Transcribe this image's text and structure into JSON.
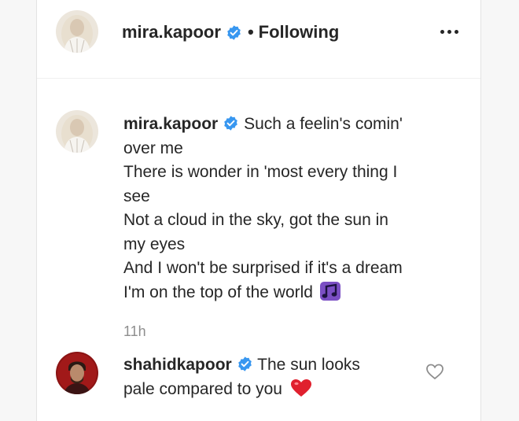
{
  "header": {
    "username": "mira.kapoor",
    "separator": "•",
    "follow_status": "Following"
  },
  "caption": {
    "username": "mira.kapoor",
    "lines": [
      "Such a feelin's comin'",
      "over me",
      "There is wonder in 'most every thing I",
      "see",
      "Not a cloud in the sky, got the sun in",
      "my eyes",
      "And I won't be surprised if it's a dream",
      "I'm on the top of the world"
    ],
    "emoji": "music-notes-emoji",
    "timestamp": "11h"
  },
  "comments": [
    {
      "username": "shahidkapoor",
      "line1": "The sun looks",
      "line2": "pale compared to you",
      "emoji": "red-heart-emoji"
    }
  ],
  "colors": {
    "verified_badge": "#3897f0",
    "heart": "#ed4956",
    "music_emoji": "#7b4fc4",
    "muted_text": "#8e8e8e"
  }
}
